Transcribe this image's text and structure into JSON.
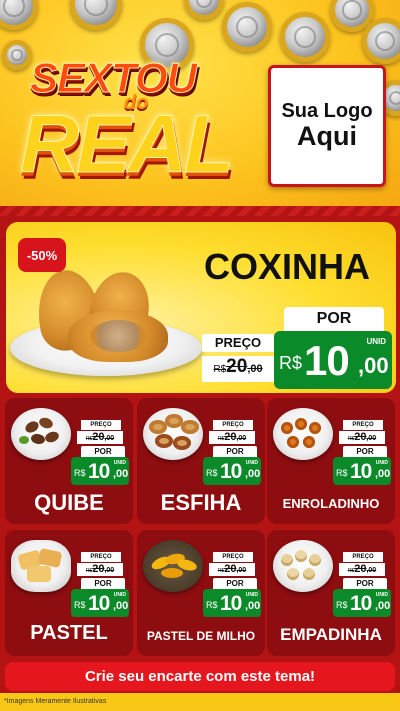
{
  "header": {
    "headline_line1": "SEXTOU",
    "headline_line2": "do",
    "headline_line3": "REAL",
    "logo_line1": "Sua Logo",
    "logo_line2": "Aqui"
  },
  "featured": {
    "discount_badge": "-50%",
    "name": "COXINHA",
    "preco_label": "PREÇO",
    "old_price_currency": "R$",
    "old_price_int": "20",
    "old_price_dec": ",00",
    "por_label": "POR",
    "unit_label": "UNID",
    "new_price_currency": "R$",
    "new_price_int": "10",
    "new_price_dec": ",00"
  },
  "card_labels": {
    "preco_label": "PREÇO",
    "por_label": "POR",
    "unit_label": "UNID",
    "currency": "R$"
  },
  "products": [
    {
      "name": "QUIBE",
      "old_price_int": "20",
      "old_price_dec": ",00",
      "new_price_int": "10",
      "new_price_dec": ",00"
    },
    {
      "name": "ESFIHA",
      "old_price_int": "20",
      "old_price_dec": ",00",
      "new_price_int": "10",
      "new_price_dec": ",00"
    },
    {
      "name": "ENROLADINHO",
      "old_price_int": "20",
      "old_price_dec": ",00",
      "new_price_int": "10",
      "new_price_dec": ",00"
    },
    {
      "name": "PASTEL",
      "old_price_int": "20",
      "old_price_dec": ",00",
      "new_price_int": "10",
      "new_price_dec": ",00"
    },
    {
      "name": "PASTEL DE MILHO",
      "old_price_int": "20",
      "old_price_dec": ",00",
      "new_price_int": "10",
      "new_price_dec": ",00"
    },
    {
      "name": "EMPADINHA",
      "old_price_int": "20",
      "old_price_dec": ",00",
      "new_price_int": "10",
      "new_price_dec": ",00"
    }
  ],
  "cta": "Crie seu encarte com este tema!",
  "footer_note": "*Imagens Meramente Ilustrativas",
  "colors": {
    "background_red": "#b31312",
    "card_red": "#8e0d10",
    "price_green": "#0b8a2a",
    "header_yellow": "#fdc41f",
    "cta_red": "#e5161d"
  }
}
